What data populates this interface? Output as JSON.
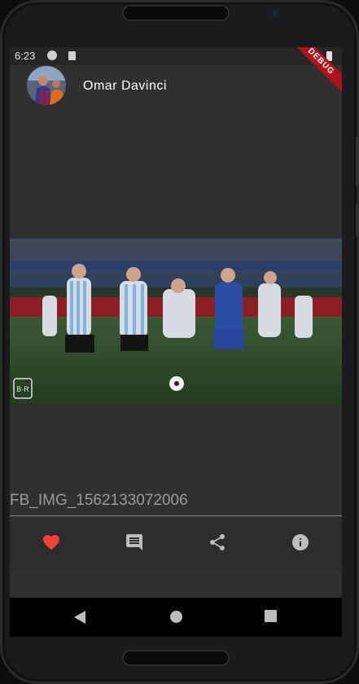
{
  "status_bar": {
    "time": "6:23"
  },
  "profile": {
    "name": "Omar Davinci"
  },
  "debug_banner": "DEBUG",
  "photo": {
    "watermark": "B·R"
  },
  "post": {
    "filename": "FB_IMG_1562133072006"
  },
  "actions": [
    {
      "icon": "heart-icon",
      "color": "#f44336"
    },
    {
      "icon": "comment-icon",
      "color": "#bdbdbd"
    },
    {
      "icon": "share-icon",
      "color": "#bdbdbd"
    },
    {
      "icon": "info-icon",
      "color": "#bdbdbd"
    }
  ],
  "navigation": [
    "back-icon",
    "home-icon",
    "recents-icon"
  ],
  "colors": {
    "background": "#303030",
    "accent_like": "#f44336",
    "banner": "#b0121b"
  }
}
